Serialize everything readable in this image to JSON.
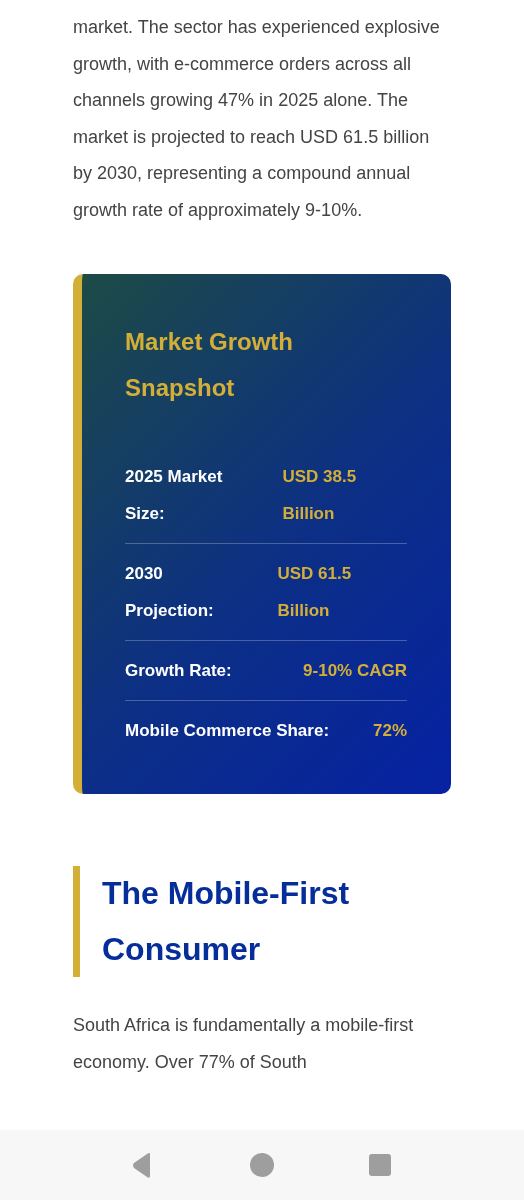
{
  "article": {
    "intro_paragraph": "market. The sector has experienced explosive growth, with e-commerce orders across all channels growing 47% in 2025 alone. The market is projected to reach USD 61.5 billion by 2030, representing a compound annual growth rate of approximately 9-10%.",
    "snapshot_card": {
      "title": "Market Growth Snapshot",
      "rows": [
        {
          "label": "2025 Market Size:",
          "value": "USD 38.5 Billion"
        },
        {
          "label": "2030 Projection:",
          "value": "USD 61.5 Billion"
        },
        {
          "label": "Growth Rate:",
          "value": "9-10% CAGR"
        },
        {
          "label": "Mobile Commerce Share:",
          "value": "72%"
        }
      ]
    },
    "section_heading": "The Mobile-First Consumer",
    "section_paragraph": "South Africa is fundamentally a mobile-first economy. Over 77% of South"
  },
  "nav_bar": {
    "buttons": [
      {
        "kind": "back"
      },
      {
        "kind": "home"
      },
      {
        "kind": "recents"
      }
    ]
  }
}
